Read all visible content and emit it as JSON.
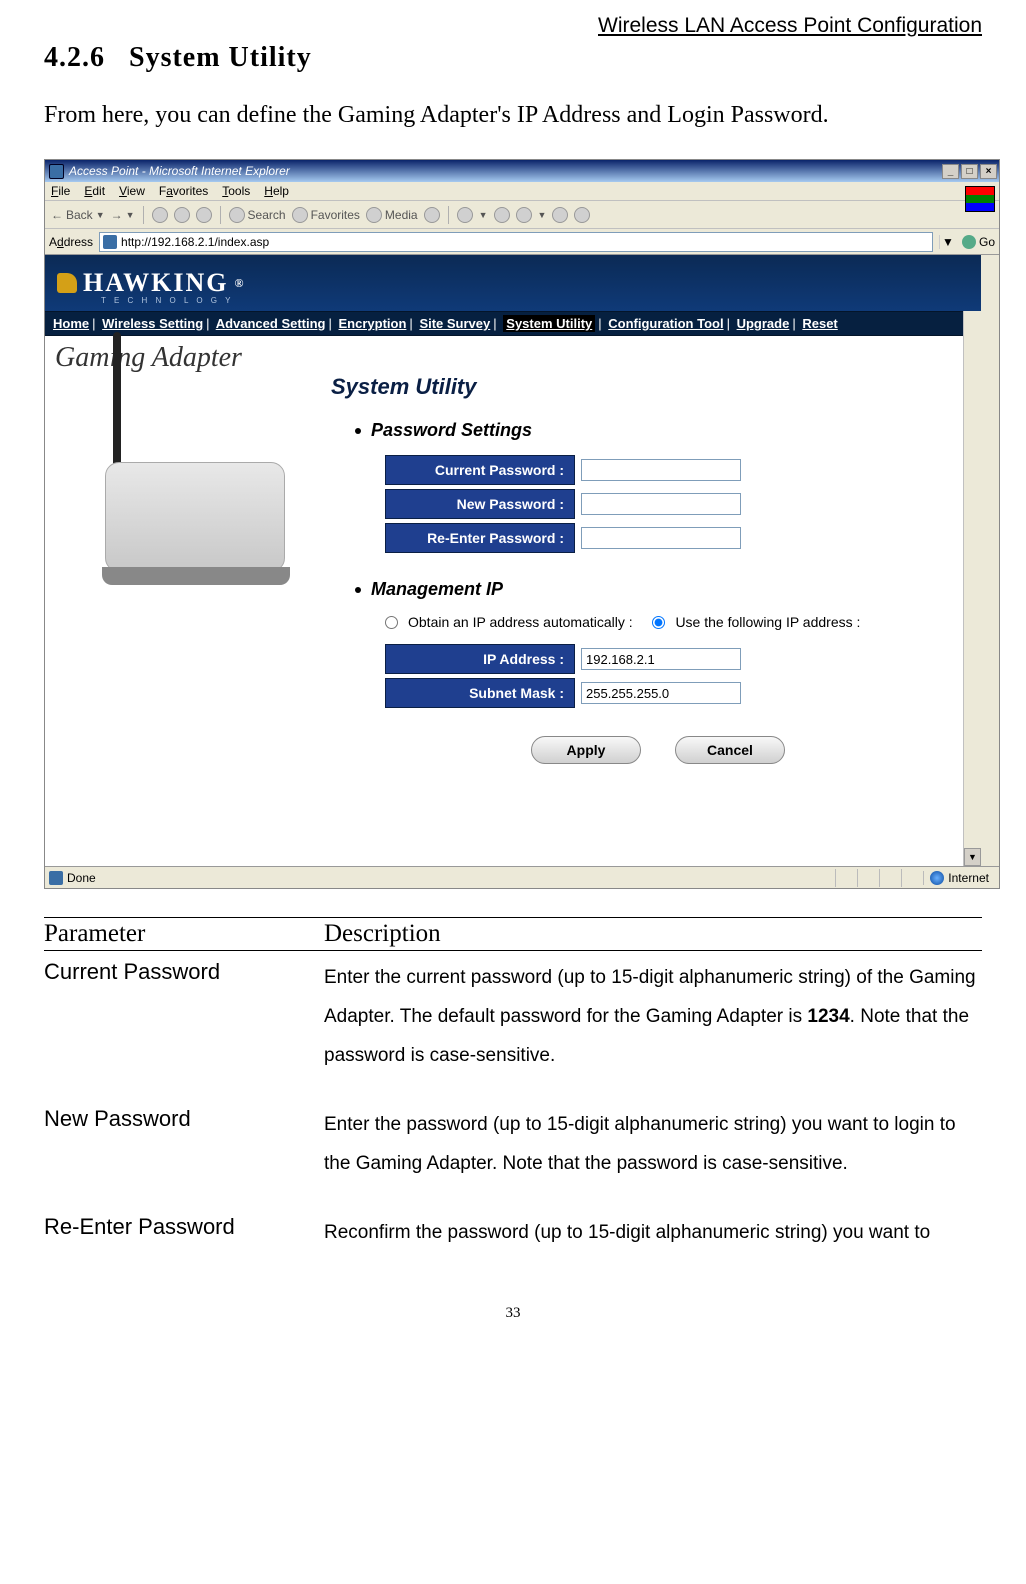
{
  "header": {
    "running_title": "Wireless LAN Access Point Configuration"
  },
  "section": {
    "number": "4.2.6",
    "title": "System Utility",
    "intro": "From here, you can define the Gaming Adapter's IP Address and Login Password."
  },
  "browser": {
    "window_title": "Access Point - Microsoft Internet Explorer",
    "window_buttons": {
      "min": "_",
      "max": "□",
      "close": "×"
    },
    "menu": {
      "file": "File",
      "edit": "Edit",
      "view": "View",
      "favorites": "Favorites",
      "tools": "Tools",
      "help": "Help"
    },
    "toolbar": {
      "back": "Back",
      "search": "Search",
      "favorites": "Favorites",
      "media": "Media"
    },
    "addressbar": {
      "label": "Address",
      "url": "http://192.168.2.1/index.asp",
      "go": "Go"
    },
    "status": {
      "left": "Done",
      "zone": "Internet"
    },
    "scroll": {
      "up": "▲",
      "down": "▼"
    }
  },
  "site": {
    "brand": "HAWKING",
    "brand_sub": "T E C H N O L O G Y",
    "nav": {
      "home": "Home",
      "wireless": "Wireless Setting",
      "advanced": "Advanced Setting",
      "encryption": "Encryption",
      "survey": "Site Survey",
      "system": "System Utility",
      "config": "Configuration Tool",
      "upgrade": "Upgrade",
      "reset": "Reset"
    },
    "content": {
      "device_title": "Gaming Adapter",
      "page_title": "System Utility",
      "password_heading": "Password Settings",
      "labels": {
        "current": "Current Password :",
        "new": "New Password :",
        "reenter": "Re-Enter Password :",
        "ip": "IP Address :",
        "subnet": "Subnet Mask :"
      },
      "mgmt_heading": "Management IP",
      "radio": {
        "auto": "Obtain an IP address automatically :",
        "manual": "Use the following IP address :"
      },
      "values": {
        "ip": "192.168.2.1",
        "subnet": "255.255.255.0"
      },
      "buttons": {
        "apply": "Apply",
        "cancel": "Cancel"
      }
    }
  },
  "param_table": {
    "head": {
      "param": "Parameter",
      "desc": "Description"
    },
    "rows": [
      {
        "param": "Current Password",
        "desc_pre": "Enter the current password (up to 15-digit alphanumeric string) of the Gaming Adapter. The default password for the Gaming Adapter is ",
        "desc_bold": "1234",
        "desc_post": ". Note that the password is case-sensitive."
      },
      {
        "param": "New Password",
        "desc_pre": "Enter the password (up to 15-digit alphanumeric string) you want to login to the Gaming Adapter. Note that the password is case-sensitive.",
        "desc_bold": "",
        "desc_post": ""
      },
      {
        "param": "Re-Enter Password",
        "desc_pre": "Reconfirm the password (up to 15-digit alphanumeric string) you want to",
        "desc_bold": "",
        "desc_post": ""
      }
    ]
  },
  "page_number": "33"
}
